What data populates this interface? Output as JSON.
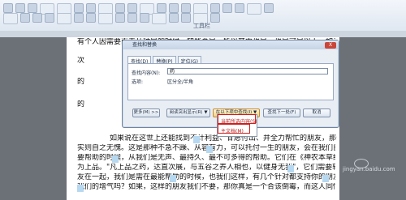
{
  "ribbon": {
    "group_label": "工具栏"
  },
  "document": {
    "line_top_1": "有个人因需要而去从种局的时候。知些总是。所以其中也是。也是可是以上，如该不做重要了。",
    "line_top_2": "次",
    "line_top_2b": "寺",
    "line_mid_1": "的",
    "line_mid_1b": "当",
    "line_mid_2": "的",
    "line_mid_2b": "它",
    "lines": [
      "如果说在这世上还能找到不计利益、甘愿付出、并全力帮忙的朋友，那么山药、薏米、芡",
      "实则自之无愧。这是那种不急不躁、从容有力，可以托付一生的朋友，会在我们自相关系，需",
      "要帮助的时候，从我们是无声、最持久、最不可多得的帮助。它们在《神农本草经》中被列",
      "为上品。\"凡上品之药，达直次展，与五谷之养人相也，以健身无我\"，它们需要轻养，如果不",
      "友在一起，我们是需在最能帮助的时候，也我们这样，有几个针对都支持你的朋友，我可能",
      "我们的增气吗？如果，这样的朋友我们不要，那你真是一个合该倒霉，而这人同情的安慰。"
    ],
    "highlight_words": [
      "药",
      "朋",
      "我们"
    ]
  },
  "dialog": {
    "title": "查找和替换",
    "close_label": "X",
    "tabs": [
      "查找(D)",
      "替换(P)",
      "定位(G)"
    ],
    "find_label": "查找内容(N):",
    "find_value": "药",
    "options_label": "选项:",
    "options_value": "区分全/半角",
    "buttons": {
      "more": "更多(M) >>",
      "reading_highlight": "阅读突出显示(R) ▼",
      "find_in": "在以下项中查找(I) ▼",
      "find_next": "查找下一处(F)",
      "cancel": "取消"
    }
  },
  "menu": {
    "items": [
      "当前所选内容(S)",
      "主文档(M)"
    ]
  },
  "watermark": {
    "text": "jingyan.baidu.com"
  }
}
